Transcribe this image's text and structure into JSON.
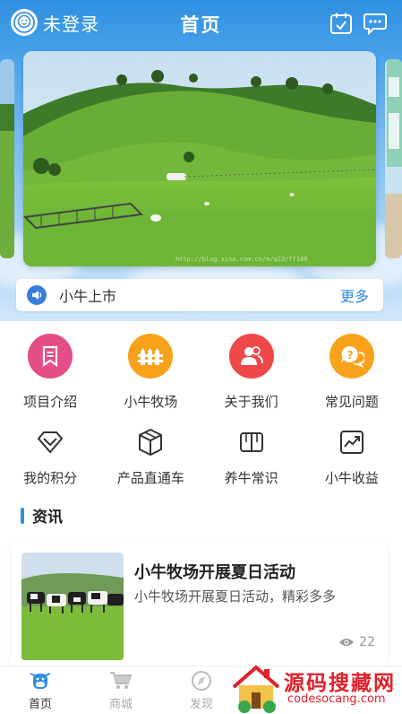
{
  "header": {
    "login_text": "未登录",
    "title": "首页"
  },
  "notice": {
    "message": "小牛上市",
    "more_label": "更多"
  },
  "banner": {
    "caption": "http://blog.sina.com.cn/m/q13/ff180"
  },
  "menu_primary": [
    {
      "label": "项目介绍",
      "color": "#e44d86"
    },
    {
      "label": "小牛牧场",
      "color": "#f7a21a"
    },
    {
      "label": "关于我们",
      "color": "#ee4848"
    },
    {
      "label": "常见问题",
      "color": "#f7a21a"
    }
  ],
  "menu_secondary": [
    {
      "label": "我的积分",
      "icon": "diamond-icon"
    },
    {
      "label": "产品直通车",
      "icon": "box-icon"
    },
    {
      "label": "养牛常识",
      "icon": "book-icon"
    },
    {
      "label": "小牛收益",
      "icon": "trend-icon"
    }
  ],
  "news": {
    "section_title": "资讯",
    "items": [
      {
        "title": "小牛牧场开展夏日活动",
        "desc": "小牛牧场开展夏日活动，精彩多多",
        "views": "22"
      }
    ]
  },
  "tabs": [
    {
      "label": "首页",
      "active": true
    },
    {
      "label": "商城",
      "active": false
    },
    {
      "label": "发现",
      "active": false
    }
  ],
  "watermark": {
    "main": "源码搜藏网",
    "sub": "codesocang.com"
  },
  "colors": {
    "primary_blue": "#2f8fe0",
    "watermark_red": "#e0202a"
  }
}
